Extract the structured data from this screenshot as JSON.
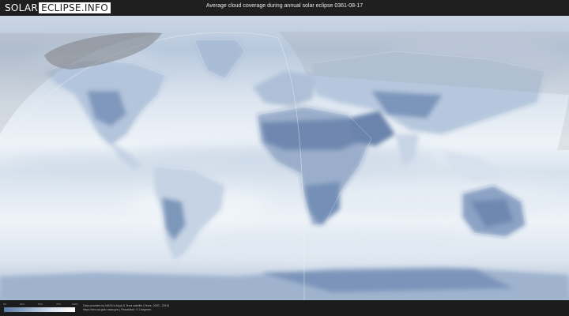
{
  "header": {
    "logo_left": "SOLAR",
    "logo_right": "ECLIPSE.INFO",
    "title": "Average cloud coverage during annual solar eclipse 0361-08-17"
  },
  "legend": {
    "ticks": [
      "0%",
      "25%",
      "50%",
      "75%",
      "100%"
    ],
    "gradient_colors": [
      "#5d7aa6",
      "#93aecd",
      "#d6e2ee",
      "#ffffff"
    ]
  },
  "credit": {
    "line1": "Data provided by NASA's Aqua & Terra satellite (Years: 2000 - 2019)",
    "line2": "https://neo.sci.gsfc.nasa.gov | Resolution: 0.1 degrees"
  }
}
